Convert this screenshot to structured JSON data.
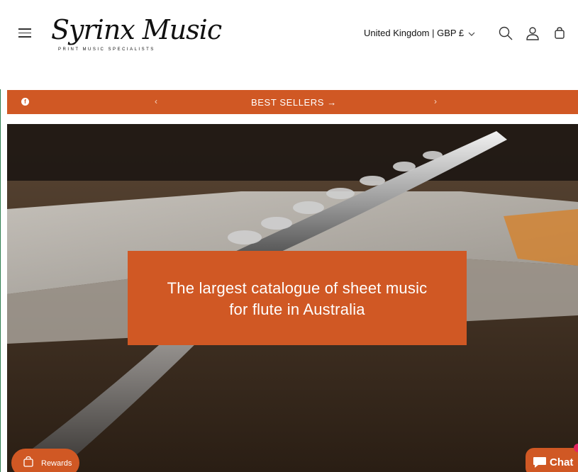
{
  "header": {
    "logo_script": "Syrinx Music",
    "logo_tagline": "PRINT MUSIC SPECIALISTS",
    "locale": "United Kingdom | GBP £",
    "icons": [
      "menu-icon",
      "search-icon",
      "account-icon",
      "cart-icon",
      "chevron-down-icon"
    ]
  },
  "announcement": {
    "social": "f",
    "prev": "‹",
    "message": "BEST SELLERS →",
    "next": "›"
  },
  "hero": {
    "line1": "The largest catalogue of sheet music",
    "line2": "for flute in Australia"
  },
  "widgets": {
    "rewards_label": "Rewards",
    "chat_label": "Chat"
  },
  "colors": {
    "accent": "#d05824",
    "text": "#121212",
    "background": "#ffffff"
  }
}
